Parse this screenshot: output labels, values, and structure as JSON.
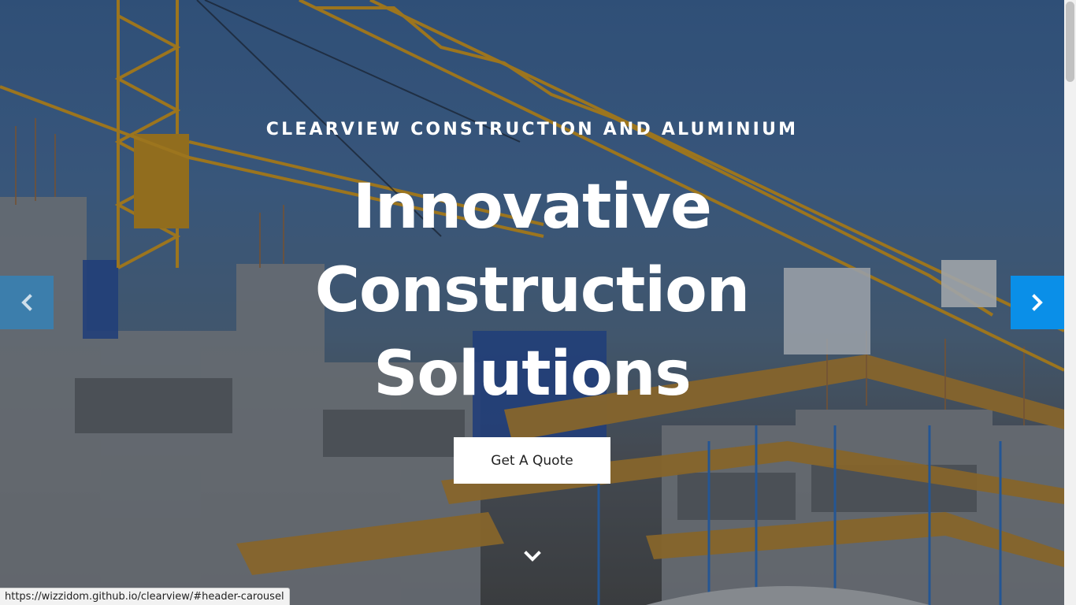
{
  "hero": {
    "eyebrow": "CLEARVIEW CONSTRUCTION AND ALUMINIUM",
    "headline_lines": [
      "Innovative",
      "Construction",
      "Solutions"
    ],
    "cta_label": "Get A Quote"
  },
  "carousel": {
    "prev_icon": "chevron-left-icon",
    "next_icon": "chevron-right-icon",
    "scroll_icon": "chevron-down-icon",
    "accent_color": "#0a8fe8"
  },
  "status_bar": {
    "url": "https://wizzidom.github.io/clearview/#header-carousel"
  }
}
